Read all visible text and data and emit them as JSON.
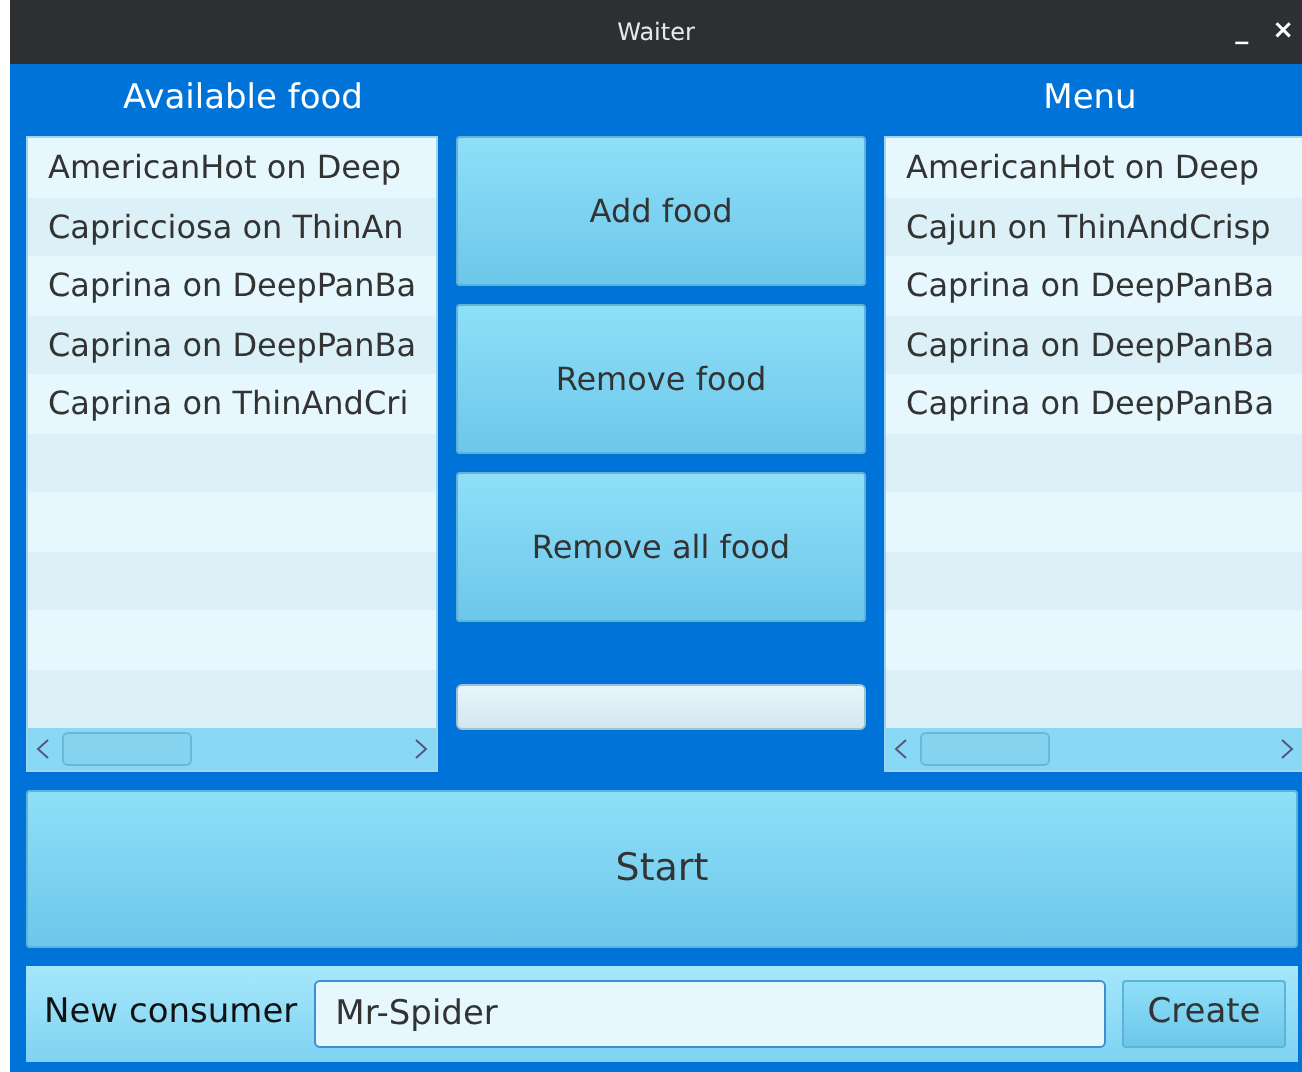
{
  "window": {
    "title": "Waiter",
    "controls": [
      "_",
      "×"
    ]
  },
  "available": {
    "title": "Available food",
    "items": [
      "AmericanHot on Deep",
      "Capricciosa on ThinAn",
      "Caprina on DeepPanBa",
      "Caprina on DeepPanBa",
      "Caprina on ThinAndCri"
    ]
  },
  "menu": {
    "title": "Menu",
    "items": [
      "AmericanHot on Deep",
      "Cajun on ThinAndCrisp",
      "Caprina on DeepPanBa",
      "Caprina on DeepPanBa",
      "Caprina on DeepPanBa"
    ]
  },
  "buttons": [
    "Add food",
    "Remove food",
    "Remove all food"
  ],
  "progress": {
    "level": 0
  },
  "start_button": "Start",
  "consumer": {
    "label": "New consumer",
    "value": "Mr-Spider",
    "button": "Create"
  }
}
